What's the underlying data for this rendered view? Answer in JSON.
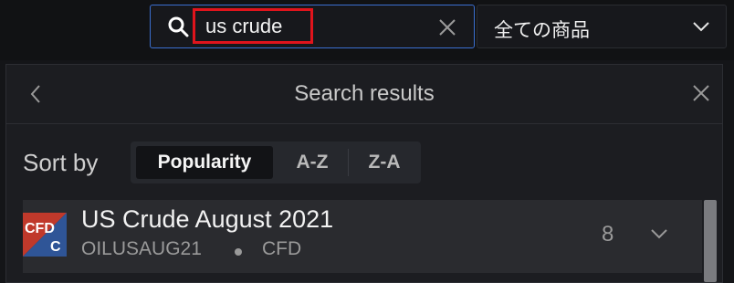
{
  "search": {
    "value": "us crude",
    "placeholder": ""
  },
  "category": {
    "selected": "全ての商品"
  },
  "panel": {
    "title": "Search results"
  },
  "sort": {
    "label": "Sort by",
    "options": [
      "Popularity",
      "A-Z",
      "Z-A"
    ],
    "active": "Popularity"
  },
  "results": [
    {
      "badge_top": "CFD",
      "badge_bottom": "C",
      "name": "US Crude August 2021",
      "symbol": "OILUSAUG21",
      "type": "CFD",
      "count": "8"
    }
  ],
  "colors": {
    "accent_border": "#3b6fd0",
    "highlight": "#e0141c",
    "badge_red": "#c0392b",
    "badge_blue": "#2f5597"
  },
  "icons": [
    "search-icon",
    "clear-icon",
    "chevron-down-icon",
    "back-icon",
    "close-icon"
  ]
}
